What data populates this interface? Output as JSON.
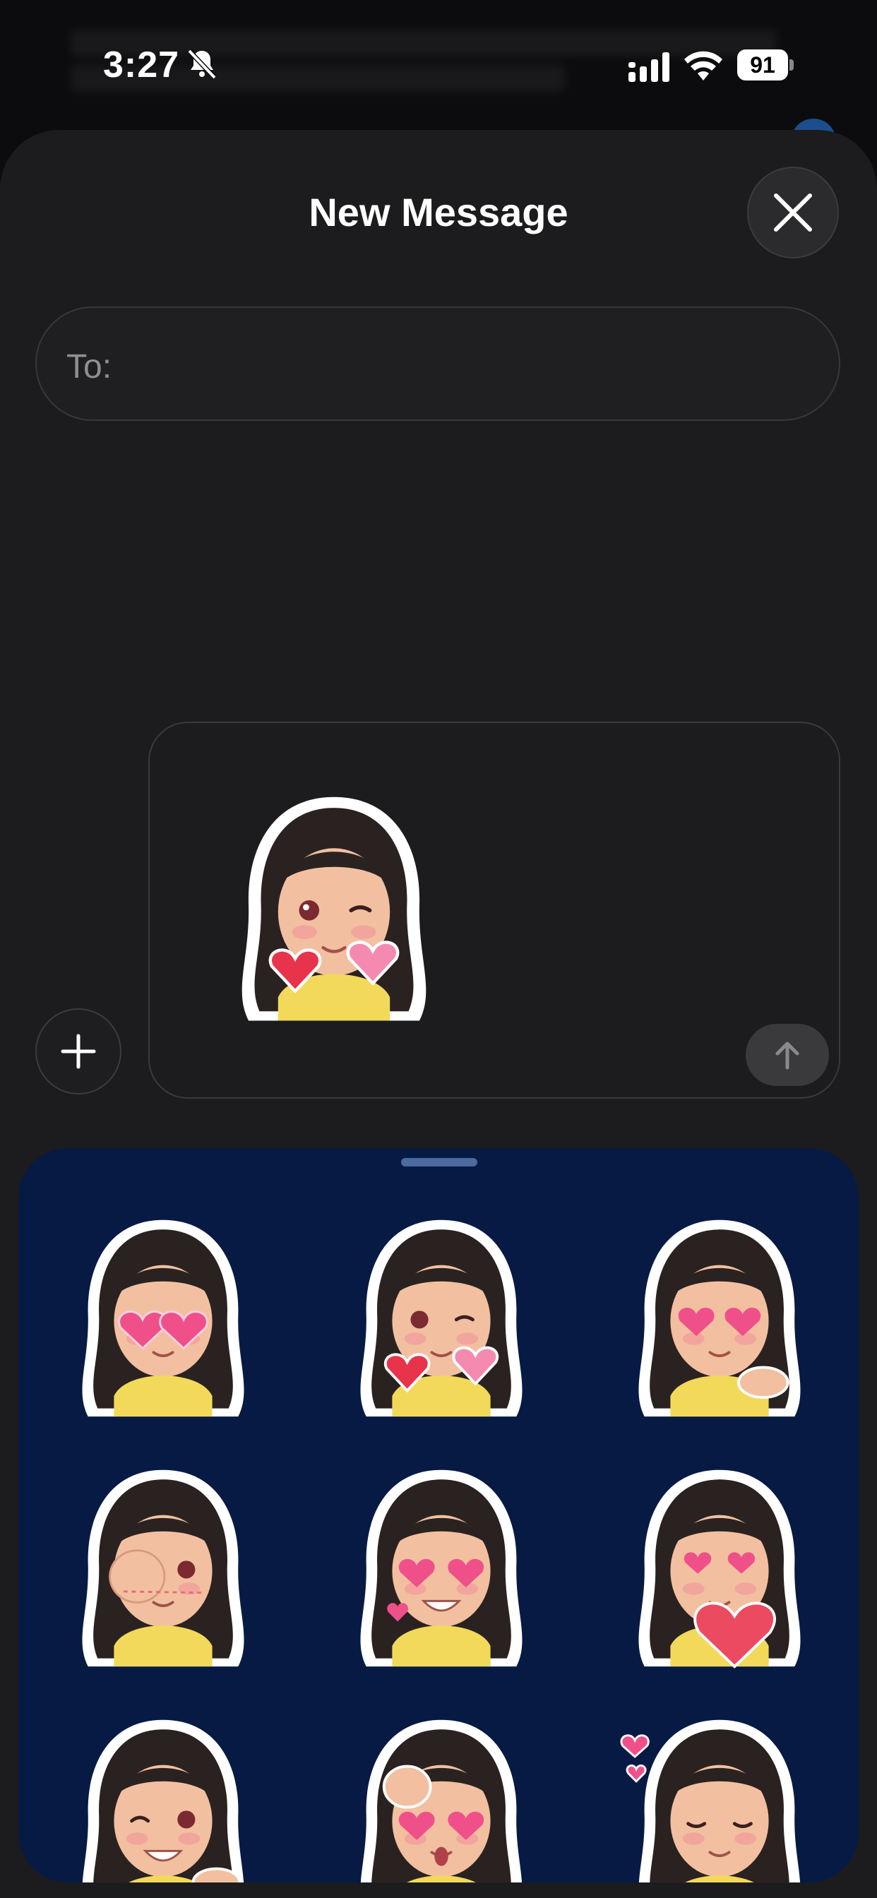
{
  "status": {
    "time": "3:27",
    "battery": "91",
    "icons": [
      "bell-slash-icon",
      "cellular-signal-icon",
      "wifi-icon",
      "battery-icon"
    ]
  },
  "sheet": {
    "title": "New Message",
    "to_label": "To:",
    "close_icon": "close-icon",
    "add_icon": "plus-icon",
    "send_icon": "arrow-up-icon"
  },
  "compose": {
    "attached_sticker": "girl-wink-holding-hearts"
  },
  "stickers": [
    {
      "name": "girl-heart-eyes"
    },
    {
      "name": "girl-wink-holding-hearts"
    },
    {
      "name": "girl-heart-eyes-blowing-kiss"
    },
    {
      "name": "girl-hand-over-eye-blushing"
    },
    {
      "name": "girl-heart-eyes-grinning"
    },
    {
      "name": "girl-hugging-big-heart"
    },
    {
      "name": "girl-wink-pointing"
    },
    {
      "name": "girl-heart-eyes-surprised"
    },
    {
      "name": "girl-self-hug-with-hearts"
    }
  ],
  "colors": {
    "sheet_bg": "#1c1c1e",
    "drawer_bg": "#061a44",
    "hair": "#2a2220",
    "heart": "#f0508a",
    "shirt": "#f2d95a"
  }
}
